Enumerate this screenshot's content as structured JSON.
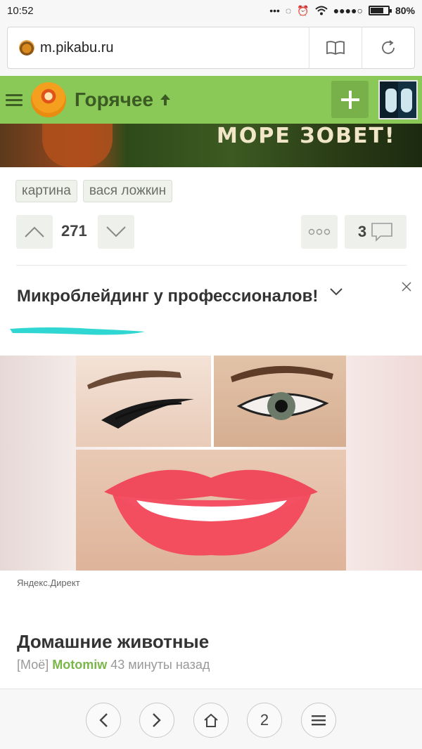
{
  "status_bar": {
    "time": "10:52",
    "battery": "80%"
  },
  "browser": {
    "url": "m.pikabu.ru",
    "tabs_count": "2"
  },
  "header": {
    "title": "Горячее",
    "plus_icon": "plus-icon"
  },
  "post": {
    "banner_text": "МОРЕ ЗОВЕТ!",
    "tags": [
      "картина",
      "вася ложкин"
    ],
    "rating": "271",
    "comments": "3"
  },
  "ad": {
    "title": "Микроблейдинг у профессионалов!",
    "source": "Яндекс.Директ"
  },
  "next_post": {
    "title": "Домашние животные",
    "community": "[Моё]",
    "author": "Motomiw",
    "time_ago": "43 минуты назад"
  },
  "colors": {
    "header_bg": "#8ac858",
    "accent_green": "#7ab648"
  }
}
